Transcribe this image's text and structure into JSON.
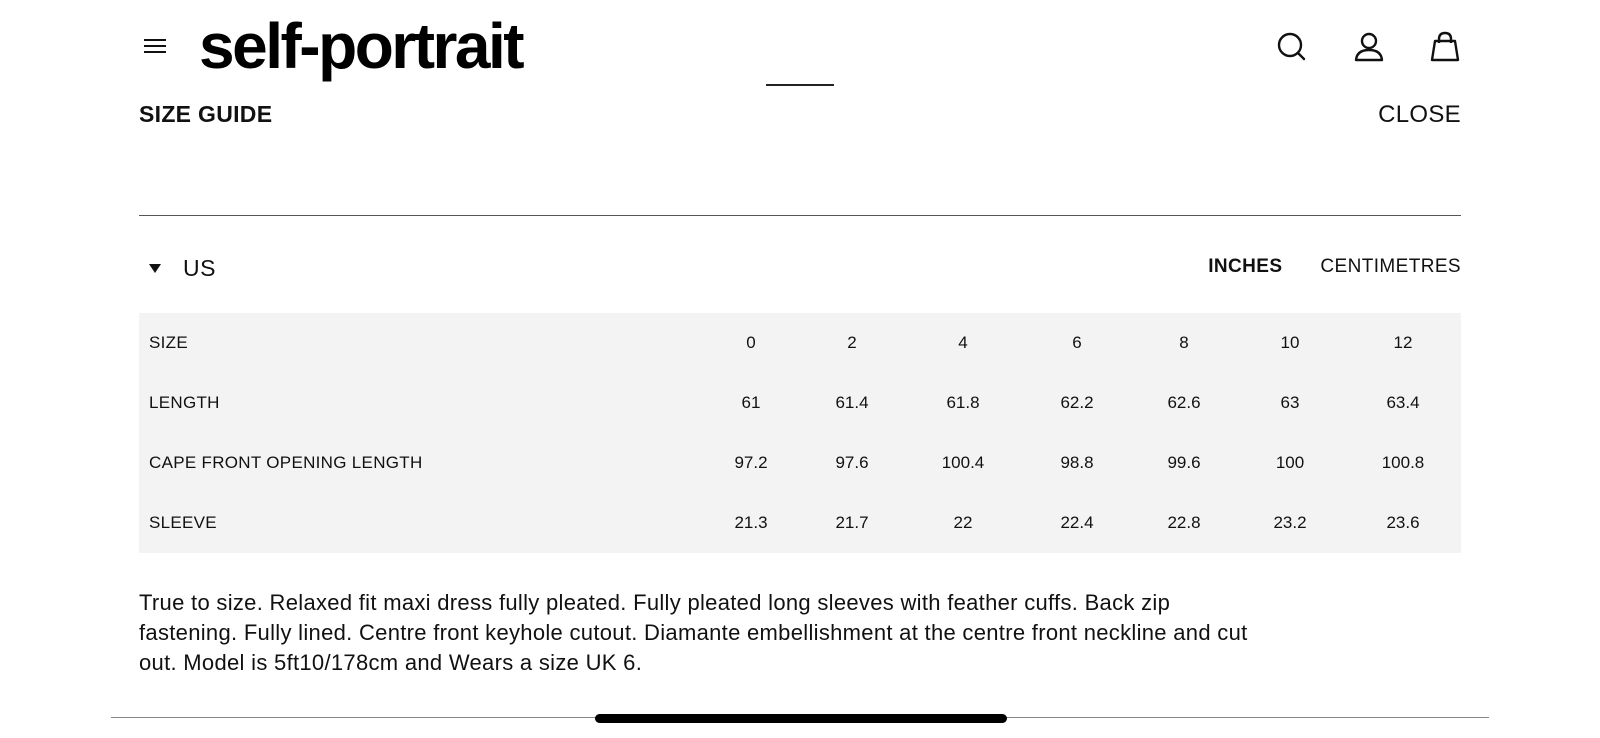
{
  "header": {
    "logo": "self-portrait"
  },
  "size_guide": {
    "title": "SIZE GUIDE",
    "close_label": "CLOSE",
    "region": "US",
    "units": {
      "inches": "INCHES",
      "centimetres": "CENTIMETRES",
      "selected": "INCHES"
    },
    "table": {
      "rows": [
        {
          "label": "SIZE",
          "values": [
            "0",
            "2",
            "4",
            "6",
            "8",
            "10",
            "12"
          ]
        },
        {
          "label": "LENGTH",
          "values": [
            "61",
            "61.4",
            "61.8",
            "62.2",
            "62.6",
            "63",
            "63.4"
          ]
        },
        {
          "label": "CAPE FRONT OPENING LENGTH",
          "values": [
            "97.2",
            "97.6",
            "100.4",
            "98.8",
            "99.6",
            "100",
            "100.8"
          ]
        },
        {
          "label": "SLEEVE",
          "values": [
            "21.3",
            "21.7",
            "22",
            "22.4",
            "22.8",
            "23.2",
            "23.6"
          ]
        }
      ]
    },
    "description": "True to size. Relaxed fit maxi dress fully pleated. Fully pleated long sleeves with feather cuffs. Back zip fastening. Fully lined. Centre front keyhole cutout. Diamante embellishment at the centre front neckline and cut out. Model is 5ft10/178cm and Wears a size UK 6."
  },
  "icons": {
    "menu": "hamburger-menu-icon",
    "search": "search-icon",
    "account": "user-icon",
    "bag": "shopping-bag-icon",
    "region_toggle": "caret-down-icon"
  }
}
